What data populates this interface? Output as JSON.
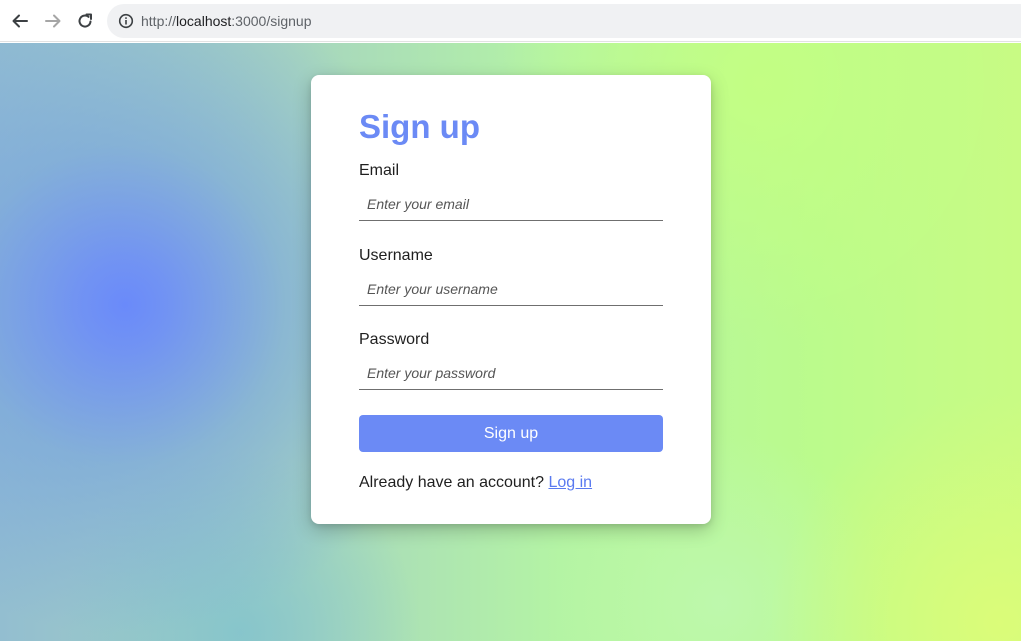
{
  "browser": {
    "url_prefix": "http://",
    "url_host": "localhost",
    "url_rest": ":3000/signup"
  },
  "icons": {
    "back": "arrow-left-icon",
    "forward": "arrow-right-icon",
    "reload": "reload-icon",
    "info": "info-icon"
  },
  "colors": {
    "accent": "#6b8af5",
    "link": "#5a7af0",
    "card_background": "#ffffff"
  },
  "signup": {
    "title": "Sign up",
    "email_label": "Email",
    "email_placeholder": "Enter your email",
    "email_value": "",
    "username_label": "Username",
    "username_placeholder": "Enter your username",
    "username_value": "",
    "password_label": "Password",
    "password_placeholder": "Enter your password",
    "password_value": "",
    "submit_label": "Sign up",
    "footer_text": "Already have an account?",
    "login_link": "Log in"
  }
}
